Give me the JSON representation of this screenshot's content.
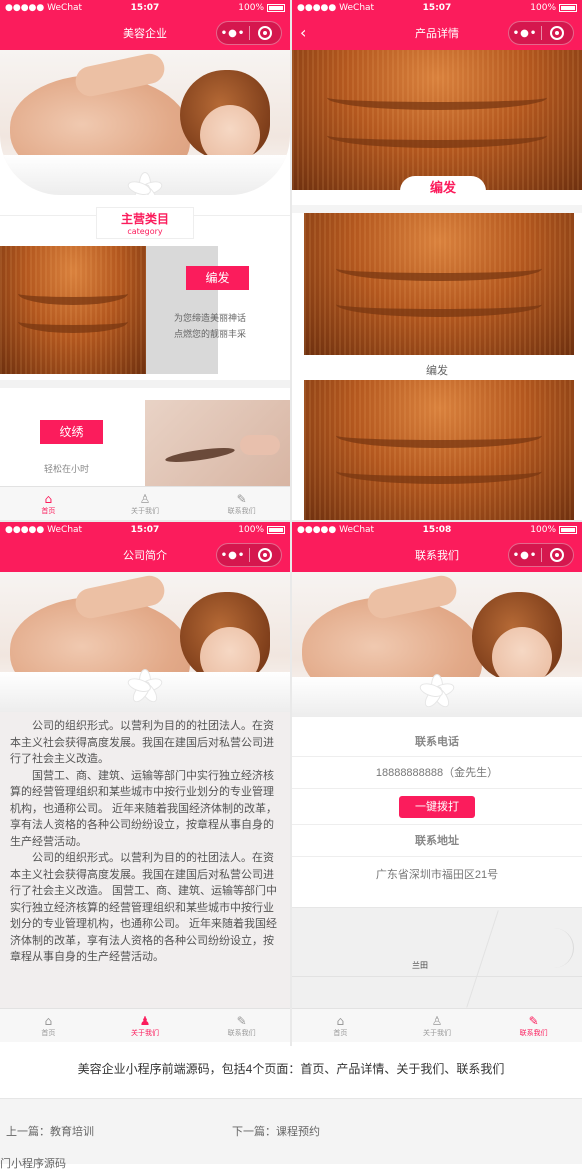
{
  "status_bar": {
    "carrier": "●●●●● WeChat",
    "battery": "100%",
    "times": [
      "15:07",
      "15:07",
      "15:07",
      "15:08"
    ]
  },
  "capsule": {
    "more": "•●•"
  },
  "colors": {
    "brand": "#fb1c5c",
    "tab_inactive": "#999999"
  },
  "tabs": {
    "home": "首页",
    "about": "关于我们",
    "contact": "联系我们"
  },
  "screen_home": {
    "title": "美容企业",
    "section_title": "主营类目",
    "section_subtitle": "category",
    "cat1_label": "编发",
    "cat1_desc_line1": "为您缔造美丽神话",
    "cat1_desc_line2": "点燃您的靓丽丰采",
    "cat2_label": "纹绣",
    "cat2_desc_line1": "轻松在小时"
  },
  "screen_product": {
    "title": "产品详情",
    "hero_badge": "编发",
    "item_caption": "编发"
  },
  "screen_about": {
    "title": "公司简介",
    "paragraphs": [
      "公司的组织形式。以营利为目的的社团法人。在资本主义社会获得高度发展。我国在建国后对私营公司进行了社会主义改造。",
      "国营工、商、建筑、运输等部门中实行独立经济核算的经营管理组织和某些城市中按行业划分的专业管理机构，也通称公司。 近年来随着我国经济体制的改革，享有法人资格的各种公司纷纷设立，按章程从事自身的生产经营活动。",
      "公司的组织形式。以营利为目的的社团法人。在资本主义社会获得高度发展。我国在建国后对私营公司进行了社会主义改造。 国营工、商、建筑、运输等部门中实行独立经济核算的经营管理组织和某些城市中按行业划分的专业管理机构，也通称公司。 近年来随着我国经济体制的改革，享有法人资格的各种公司纷纷设立，按章程从事自身的生产经营活动。"
    ]
  },
  "screen_contact": {
    "title": "联系我们",
    "phone_heading": "联系电话",
    "phone_value": "18888888888（金先生）",
    "call_button": "一键拨打",
    "address_heading": "联系地址",
    "address_value": "广东省深圳市福田区21号",
    "map_label": "兰田"
  },
  "caption": "美容企业小程序前端源码，包括4个页面：首页、产品详情、关于我们、联系我们",
  "footer": {
    "prev": "上一篇：教育培训",
    "next": "下一篇：课程预约",
    "bottom": "门小程序源码"
  }
}
